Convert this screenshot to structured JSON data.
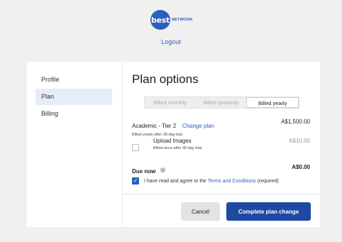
{
  "brand": {
    "logo_text": "best",
    "logo_subtext": "NETWORK",
    "accent_color": "#2b5fb8"
  },
  "header": {
    "logout_label": "Logout"
  },
  "sidebar": {
    "items": [
      {
        "label": "Profile",
        "active": false
      },
      {
        "label": "Plan",
        "active": true
      },
      {
        "label": "Billing",
        "active": false
      }
    ]
  },
  "main": {
    "title": "Plan options",
    "billing_toggle": {
      "options": [
        "Billed monthly",
        "Billed quarterly",
        "Billed yearly"
      ],
      "selected": "Billed yearly"
    },
    "plan": {
      "name": "Academic - Tier 2",
      "change_label": "Change plan",
      "price": "A$1,500.00",
      "subtext": "Billed yearly after 30-day trial"
    },
    "addon": {
      "name": "Upload Images",
      "subtext": "Billed once after 30-day trial",
      "price": "A$10.00",
      "checked": false
    },
    "due": {
      "label": "Due now",
      "icon": "info-icon",
      "price": "A$0.00"
    },
    "agreement": {
      "checked": true,
      "prefix": "I have read and agree to the",
      "link_text": "Terms and Conditions",
      "suffix": "(required)"
    },
    "actions": {
      "cancel_label": "Cancel",
      "confirm_label": "Complete plan change"
    }
  }
}
